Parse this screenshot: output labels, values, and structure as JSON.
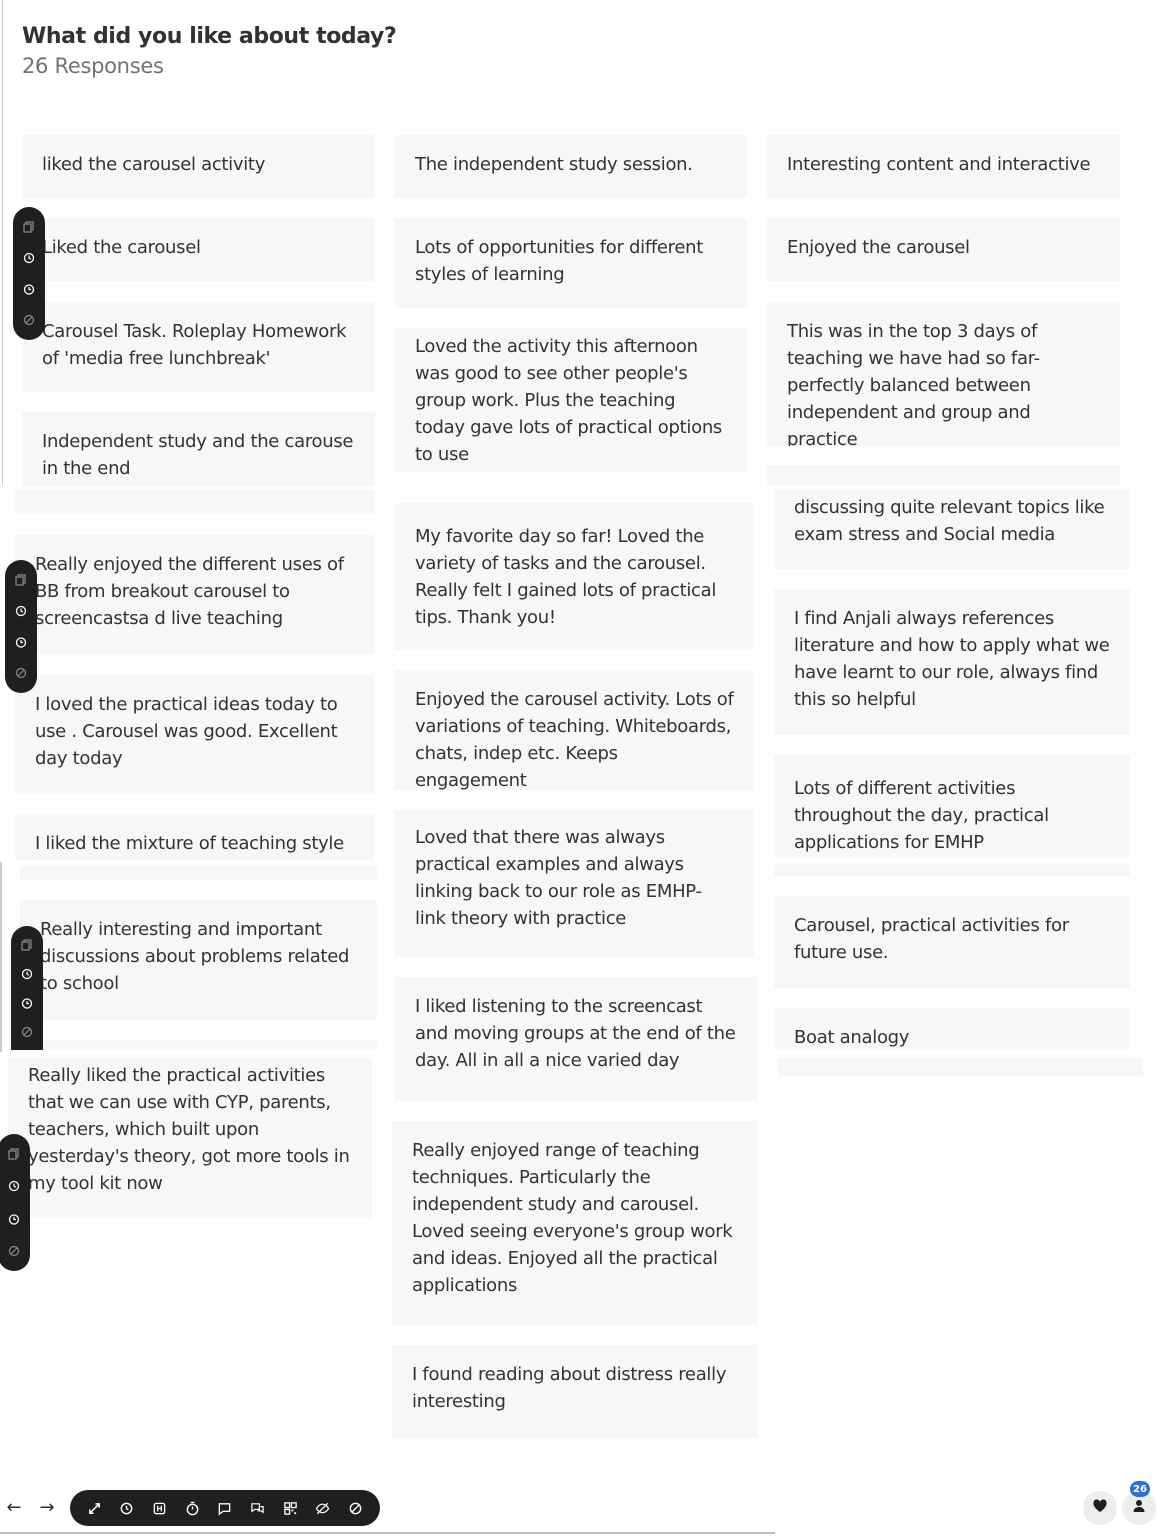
{
  "header": {
    "question": "What did you like about today?",
    "responses": "26 Responses"
  },
  "cards": [
    "liked the carousel activity",
    "Liked the carousel",
    "Carousel Task. Roleplay Homework of 'media free lunchbreak'",
    "Independent study and the carouse in the end",
    "Really enjoyed the different uses of BB from breakout carousel to screencastsa d live teaching",
    "I loved the practical ideas today to use . Carousel was good. Excellent day today",
    "I liked the mixture of teaching style :)",
    "Really interesting and important discussions about problems related to school",
    "Really liked the practical activities that we can use with CYP, parents, teachers, which built upon yesterday's theory, got more tools in my tool kit now",
    "The independent study session.",
    "Lots of opportunities for different styles of learning",
    "Loved the activity this afternoon was good to see other people's group work. Plus the teaching today gave lots of practical options to use",
    "My favorite day so far! Loved the variety of tasks and the carousel. Really felt I gained lots of practical tips. Thank you!",
    "Enjoyed the carousel activity. Lots of variations of teaching. Whiteboards, chats, indep etc. Keeps engagement",
    "Loved that there was always practical examples and always linking back to our role as EMHP- link theory with practice",
    "I liked listening to the screencast and moving groups at the end of the day. All in all a nice varied day",
    "Really enjoyed range of teaching techniques. Particularly the independent study and carousel. Loved seeing everyone's group work and ideas. Enjoyed all the practical applications",
    "I found reading about distress really interesting",
    "Interesting content and interactive",
    "Enjoyed the carousel",
    "This was in the top 3 days of teaching we have had so far- perfectly balanced between independent and group and practice",
    "discussing quite relevant topics like exam stress and Social media",
    "I find Anjali always references literature and how to apply what we have learnt to our role, always find this so helpful",
    "Lots of different activities throughout the day, practical applications for EMHP",
    "Carousel, practical activities for future use.",
    "Boat analogy"
  ],
  "card_toolbar_icons": [
    "copy-icon",
    "history-icon",
    "timer-icon",
    "hide-icon"
  ],
  "bottom_toolbar_icons": [
    "expand-icon",
    "history-icon",
    "highlight-icon",
    "timer-icon",
    "comment-icon",
    "chat-icon",
    "qr-code-icon",
    "hide-results-icon",
    "block-icon"
  ],
  "nav": {
    "prev": "←",
    "next": "→"
  },
  "participants_count": "26",
  "colors": {
    "card_bg": "#f6f7f7",
    "toolbar_bg": "#1e1f21",
    "badge": "#2f6fd8"
  }
}
